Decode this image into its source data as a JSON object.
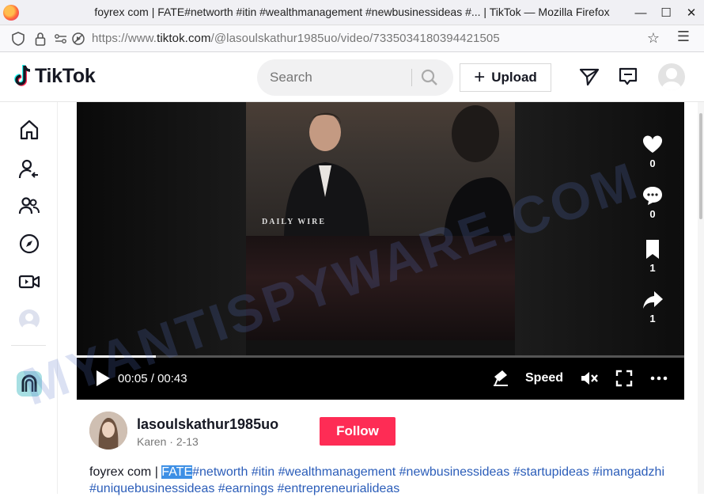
{
  "browser": {
    "window_title": "foyrex com | FATE#networth #itin #wealthmanagement #newbusinessideas #... | TikTok — Mozilla Firefox",
    "url_prefix": "https://www.",
    "url_domain": "tiktok.com",
    "url_path": "/@lasoulskathur1985uo/video/7335034180394421505"
  },
  "header": {
    "logo_text": "TikTok",
    "search_placeholder": "Search",
    "upload_label": "Upload"
  },
  "sidebar": {
    "items": [
      "home",
      "following",
      "friends",
      "explore",
      "live",
      "profile",
      "app"
    ]
  },
  "video": {
    "overlay_text": "DAILY WIRE",
    "time_current": "00:05",
    "time_total": "00:43",
    "time_separator": "/",
    "speed_label": "Speed",
    "progress": 0.13,
    "likes": "0",
    "comments": "0",
    "saves": "1",
    "shares": "1"
  },
  "author": {
    "username": "lasoulskathur1985uo",
    "nickname": "Karen",
    "date": "2-13",
    "follow_label": "Follow"
  },
  "description": {
    "prefix": "foyrex com | ",
    "highlight": "FATE",
    "tags": [
      "#networth",
      "#itin",
      "#wealthmanagement",
      "#newbusinessideas",
      "#startupideas",
      "#imangadzhi",
      "#uniquebusinessideas",
      "#earnings",
      "#entrepreneurialideas"
    ]
  },
  "watermark": "MYANTISPYWARE.COM",
  "colors": {
    "follow_bg": "#fe2c55",
    "hashtag": "#2b5db9",
    "highlight": "#3d8fe5"
  }
}
